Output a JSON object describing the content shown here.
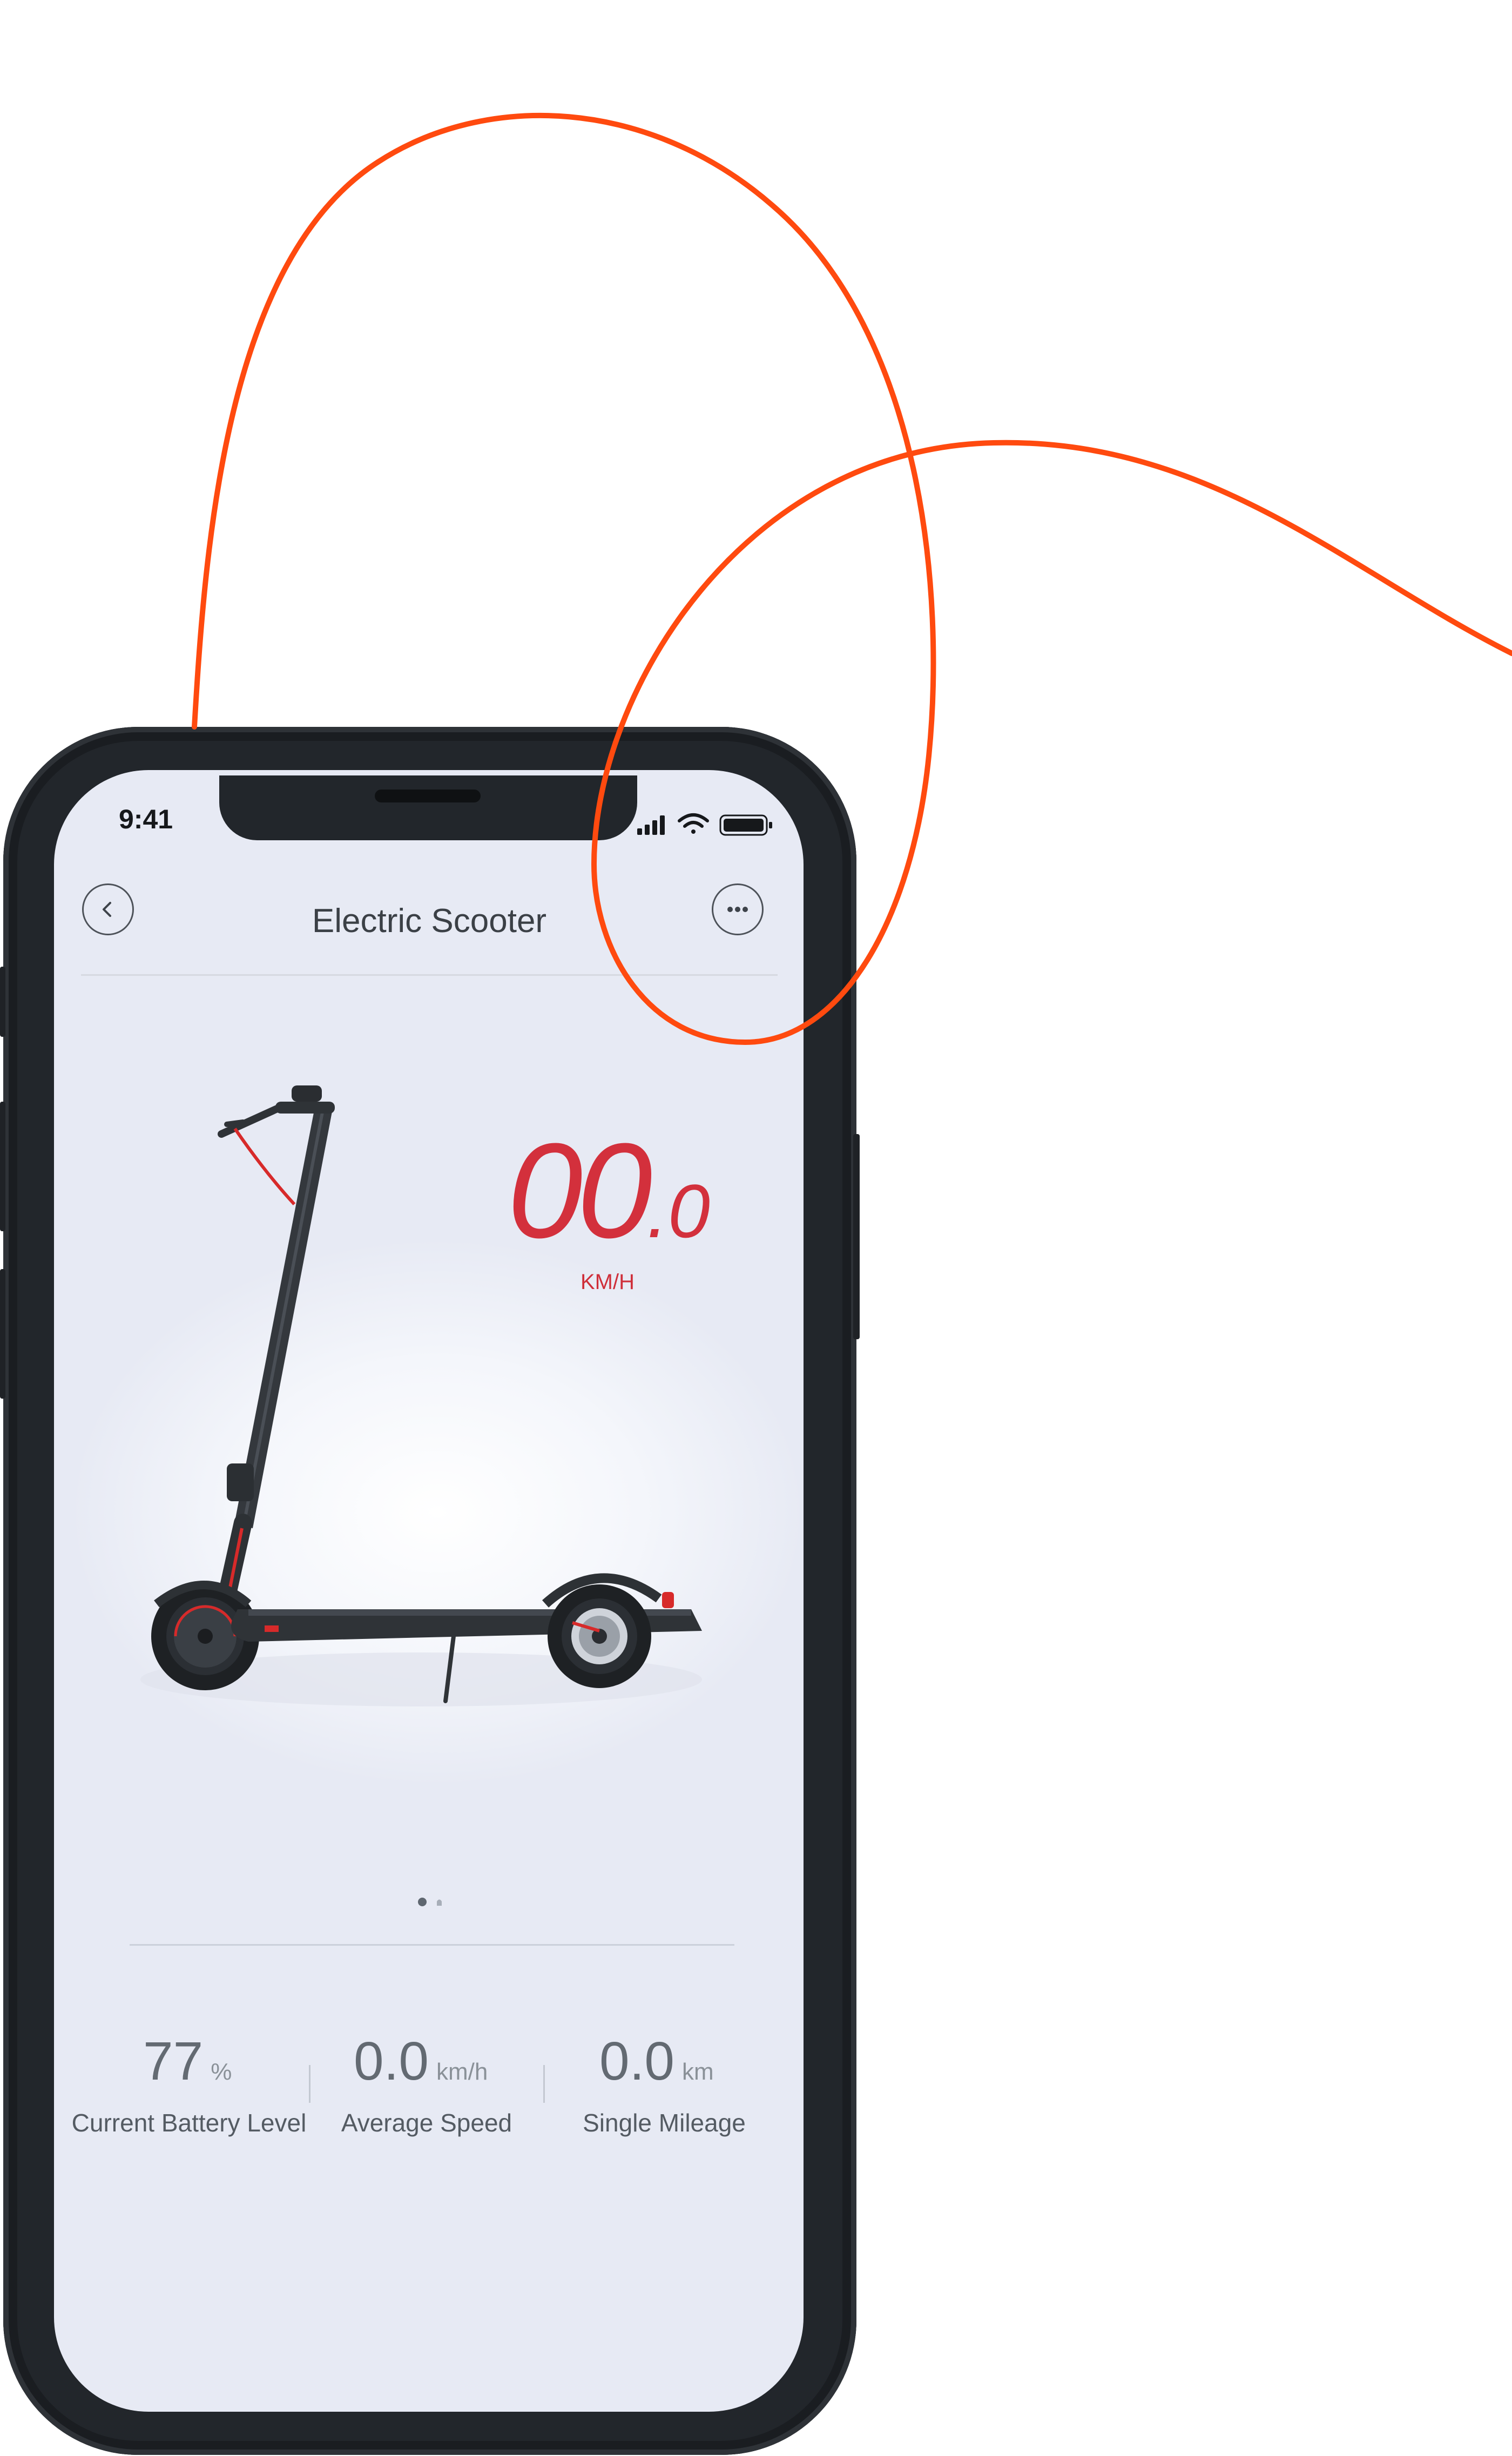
{
  "status_bar": {
    "time": "9:41"
  },
  "header": {
    "title": "Electric Scooter",
    "back_icon": "chevron-left-icon",
    "more_icon": "more-dots-icon"
  },
  "speed": {
    "integer": "00",
    "decimal": ".0",
    "unit": "KM/H",
    "color": "#d3303c"
  },
  "carousel": {
    "pages": 2,
    "active": 1
  },
  "stats": [
    {
      "value": "77",
      "unit": "%",
      "label": "Current Battery Level"
    },
    {
      "value": "0.0",
      "unit": "km/h",
      "label": "Average Speed"
    },
    {
      "value": "0.0",
      "unit": "km",
      "label": "Single Mileage"
    }
  ],
  "colors": {
    "accent_line": "#ff4a0f",
    "screen_bg": "#e7eaf4",
    "phone_frame": "#22262b"
  }
}
